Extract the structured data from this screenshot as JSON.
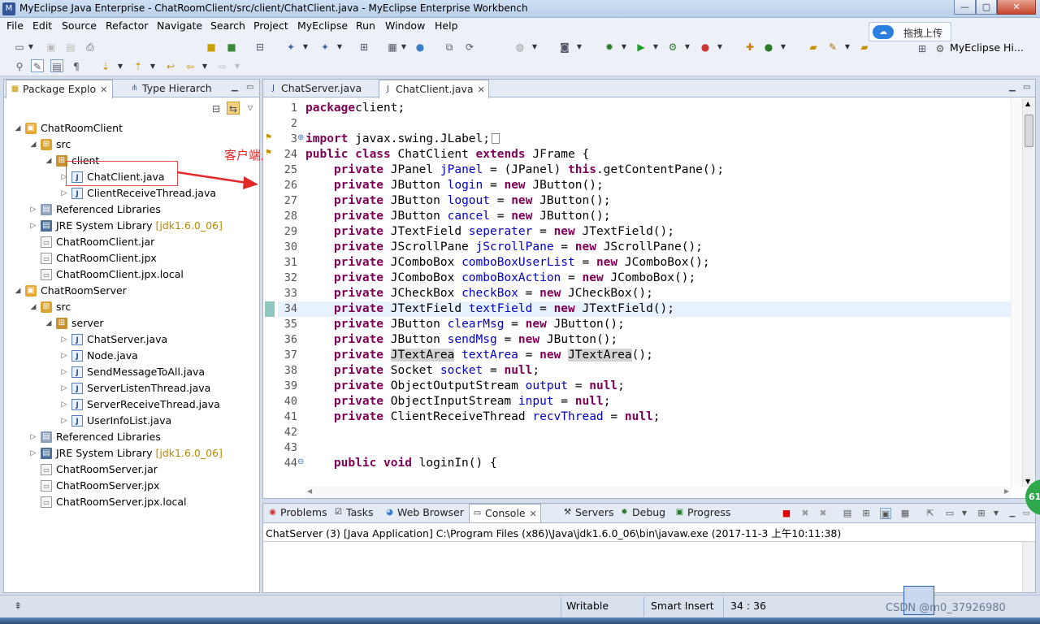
{
  "window": {
    "title": "MyEclipse Java Enterprise - ChatRoomClient/src/client/ChatClient.java - MyEclipse Enterprise Workbench",
    "app_icon": "M",
    "minimize": "—",
    "maximize": "▢",
    "close": "✕"
  },
  "menu": [
    "File",
    "Edit",
    "Source",
    "Refactor",
    "Navigate",
    "Search",
    "Project",
    "MyEclipse",
    "Run",
    "Window",
    "Help"
  ],
  "upload_widget": {
    "label": "拖拽上传",
    "icon": "cloud-icon"
  },
  "perspective": {
    "label": "MyEclipse Hi..."
  },
  "package_explorer": {
    "tabs": [
      {
        "label": "Package Explo",
        "close": "✕",
        "icon": "package-explorer-icon"
      },
      {
        "label": "Type Hierarch",
        "icon": "type-hierarchy-icon"
      }
    ],
    "tree": [
      {
        "depth": 0,
        "expanded": true,
        "icon": "proj",
        "label": "ChatRoomClient"
      },
      {
        "depth": 1,
        "expanded": true,
        "icon": "src",
        "label": "src"
      },
      {
        "depth": 2,
        "expanded": true,
        "icon": "pkg",
        "label": "client"
      },
      {
        "depth": 3,
        "expanded": false,
        "icon": "java",
        "label": "ChatClient.java",
        "selected": true
      },
      {
        "depth": 3,
        "expanded": false,
        "icon": "java",
        "label": "ClientReceiveThread.java"
      },
      {
        "depth": 1,
        "expanded": false,
        "icon": "lib",
        "label": "Referenced Libraries"
      },
      {
        "depth": 1,
        "expanded": false,
        "icon": "jre",
        "label": "JRE System Library",
        "suffix": "[jdk1.6.0_06]"
      },
      {
        "depth": 1,
        "leaf": true,
        "icon": "file",
        "label": "ChatRoomClient.jar"
      },
      {
        "depth": 1,
        "leaf": true,
        "icon": "file",
        "label": "ChatRoomClient.jpx"
      },
      {
        "depth": 1,
        "leaf": true,
        "icon": "file",
        "label": "ChatRoomClient.jpx.local"
      },
      {
        "depth": 0,
        "expanded": true,
        "icon": "proj",
        "label": "ChatRoomServer"
      },
      {
        "depth": 1,
        "expanded": true,
        "icon": "src",
        "label": "src"
      },
      {
        "depth": 2,
        "expanded": true,
        "icon": "pkg",
        "label": "server"
      },
      {
        "depth": 3,
        "expanded": false,
        "icon": "java",
        "label": "ChatServer.java"
      },
      {
        "depth": 3,
        "expanded": false,
        "icon": "java",
        "label": "Node.java"
      },
      {
        "depth": 3,
        "expanded": false,
        "icon": "java",
        "label": "SendMessageToAll.java"
      },
      {
        "depth": 3,
        "expanded": false,
        "icon": "java",
        "label": "ServerListenThread.java"
      },
      {
        "depth": 3,
        "expanded": false,
        "icon": "java",
        "label": "ServerReceiveThread.java"
      },
      {
        "depth": 3,
        "expanded": false,
        "icon": "java",
        "label": "UserInfoList.java"
      },
      {
        "depth": 1,
        "expanded": false,
        "icon": "lib",
        "label": "Referenced Libraries"
      },
      {
        "depth": 1,
        "expanded": false,
        "icon": "jre",
        "label": "JRE System Library",
        "suffix": "[jdk1.6.0_06]"
      },
      {
        "depth": 1,
        "leaf": true,
        "icon": "file",
        "label": "ChatRoomServer.jar"
      },
      {
        "depth": 1,
        "leaf": true,
        "icon": "file",
        "label": "ChatRoomServer.jpx"
      },
      {
        "depth": 1,
        "leaf": true,
        "icon": "file",
        "label": "ChatRoomServer.jpx.local"
      }
    ]
  },
  "annotation": {
    "text": "客户端启动",
    "color": "#e32a2a"
  },
  "editor": {
    "tabs": [
      {
        "label": "ChatServer.java",
        "active": false
      },
      {
        "label": "ChatClient.java",
        "active": true,
        "close": "✕"
      }
    ],
    "current_line": "34",
    "lines": [
      {
        "n": "1",
        "tokens": [
          [
            "kw",
            "package"
          ],
          [
            "",
            "client;"
          ]
        ]
      },
      {
        "n": "2",
        "tokens": []
      },
      {
        "n": "3",
        "fold": "⊕",
        "tokens": [
          [
            "kw",
            "import"
          ],
          [
            "",
            " javax.swing.JLabel;"
          ],
          [
            "box",
            "..."
          ]
        ]
      },
      {
        "n": "24",
        "tokens": [
          [
            "kw",
            "public class"
          ],
          [
            "",
            " ChatClient "
          ],
          [
            "kw",
            "extends"
          ],
          [
            "",
            " JFrame {"
          ]
        ]
      },
      {
        "n": "25",
        "tokens": [
          [
            "",
            "    "
          ],
          [
            "kw",
            "private"
          ],
          [
            "",
            " JPanel "
          ],
          [
            "fld",
            "jPanel"
          ],
          [
            "",
            " = (JPanel) "
          ],
          [
            "kw",
            "this"
          ],
          [
            "",
            ".getContentPane();"
          ]
        ]
      },
      {
        "n": "26",
        "tokens": [
          [
            "",
            "    "
          ],
          [
            "kw",
            "private"
          ],
          [
            "",
            " JButton "
          ],
          [
            "fld",
            "login"
          ],
          [
            "",
            " = "
          ],
          [
            "kw",
            "new"
          ],
          [
            "",
            " JButton();"
          ]
        ]
      },
      {
        "n": "27",
        "tokens": [
          [
            "",
            "    "
          ],
          [
            "kw",
            "private"
          ],
          [
            "",
            " JButton "
          ],
          [
            "fld",
            "logout"
          ],
          [
            "",
            " = "
          ],
          [
            "kw",
            "new"
          ],
          [
            "",
            " JButton();"
          ]
        ]
      },
      {
        "n": "28",
        "tokens": [
          [
            "",
            "    "
          ],
          [
            "kw",
            "private"
          ],
          [
            "",
            " JButton "
          ],
          [
            "fld",
            "cancel"
          ],
          [
            "",
            " = "
          ],
          [
            "kw",
            "new"
          ],
          [
            "",
            " JButton();"
          ]
        ]
      },
      {
        "n": "29",
        "tokens": [
          [
            "",
            "    "
          ],
          [
            "kw",
            "private"
          ],
          [
            "",
            " JTextField "
          ],
          [
            "fld",
            "seperater"
          ],
          [
            "",
            " = "
          ],
          [
            "kw",
            "new"
          ],
          [
            "",
            " JTextField();"
          ]
        ]
      },
      {
        "n": "30",
        "tokens": [
          [
            "",
            "    "
          ],
          [
            "kw",
            "private"
          ],
          [
            "",
            " JScrollPane "
          ],
          [
            "fld",
            "jScrollPane"
          ],
          [
            "",
            " = "
          ],
          [
            "kw",
            "new"
          ],
          [
            "",
            " JScrollPane();"
          ]
        ]
      },
      {
        "n": "31",
        "tokens": [
          [
            "",
            "    "
          ],
          [
            "kw",
            "private"
          ],
          [
            "",
            " JComboBox "
          ],
          [
            "fld",
            "comboBoxUserList"
          ],
          [
            "",
            " = "
          ],
          [
            "kw",
            "new"
          ],
          [
            "",
            " JComboBox();"
          ]
        ]
      },
      {
        "n": "32",
        "tokens": [
          [
            "",
            "    "
          ],
          [
            "kw",
            "private"
          ],
          [
            "",
            " JComboBox "
          ],
          [
            "fld",
            "comboBoxAction"
          ],
          [
            "",
            " = "
          ],
          [
            "kw",
            "new"
          ],
          [
            "",
            " JComboBox();"
          ]
        ]
      },
      {
        "n": "33",
        "tokens": [
          [
            "",
            "    "
          ],
          [
            "kw",
            "private"
          ],
          [
            "",
            " JCheckBox "
          ],
          [
            "fld",
            "checkBox"
          ],
          [
            "",
            " = "
          ],
          [
            "kw",
            "new"
          ],
          [
            "",
            " JCheckBox();"
          ]
        ]
      },
      {
        "n": "34",
        "tokens": [
          [
            "",
            "    "
          ],
          [
            "kw",
            "private"
          ],
          [
            "",
            " JTextField "
          ],
          [
            "fld",
            "textField"
          ],
          [
            "",
            " = "
          ],
          [
            "kw",
            "new"
          ],
          [
            "",
            " JTextField();"
          ]
        ]
      },
      {
        "n": "35",
        "tokens": [
          [
            "",
            "    "
          ],
          [
            "kw",
            "private"
          ],
          [
            "",
            " JButton "
          ],
          [
            "fld",
            "clearMsg"
          ],
          [
            "",
            " = "
          ],
          [
            "kw",
            "new"
          ],
          [
            "",
            " JButton();"
          ]
        ]
      },
      {
        "n": "36",
        "tokens": [
          [
            "",
            "    "
          ],
          [
            "kw",
            "private"
          ],
          [
            "",
            " JButton "
          ],
          [
            "fld",
            "sendMsg"
          ],
          [
            "",
            " = "
          ],
          [
            "kw",
            "new"
          ],
          [
            "",
            " JButton();"
          ]
        ]
      },
      {
        "n": "37",
        "tokens": [
          [
            "",
            "    "
          ],
          [
            "kw",
            "private"
          ],
          [
            "",
            " "
          ],
          [
            "occ",
            "JTextArea"
          ],
          [
            "",
            " "
          ],
          [
            "fld",
            "textArea"
          ],
          [
            "",
            " = "
          ],
          [
            "kw",
            "new"
          ],
          [
            "",
            " "
          ],
          [
            "occ",
            "JTextArea"
          ],
          [
            "",
            "();"
          ]
        ]
      },
      {
        "n": "38",
        "tokens": [
          [
            "",
            "    "
          ],
          [
            "kw",
            "private"
          ],
          [
            "",
            " Socket "
          ],
          [
            "fld",
            "socket"
          ],
          [
            "",
            " = "
          ],
          [
            "kw",
            "null"
          ],
          [
            "",
            ";"
          ]
        ]
      },
      {
        "n": "39",
        "tokens": [
          [
            "",
            "    "
          ],
          [
            "kw",
            "private"
          ],
          [
            "",
            " ObjectOutputStream "
          ],
          [
            "fld",
            "output"
          ],
          [
            "",
            " = "
          ],
          [
            "kw",
            "null"
          ],
          [
            "",
            ";"
          ]
        ]
      },
      {
        "n": "40",
        "tokens": [
          [
            "",
            "    "
          ],
          [
            "kw",
            "private"
          ],
          [
            "",
            " ObjectInputStream "
          ],
          [
            "fld",
            "input"
          ],
          [
            "",
            " = "
          ],
          [
            "kw",
            "null"
          ],
          [
            "",
            ";"
          ]
        ]
      },
      {
        "n": "41",
        "tokens": [
          [
            "",
            "    "
          ],
          [
            "kw",
            "private"
          ],
          [
            "",
            " ClientReceiveThread "
          ],
          [
            "fld",
            "recvThread"
          ],
          [
            "",
            " = "
          ],
          [
            "kw",
            "null"
          ],
          [
            "",
            ";"
          ]
        ]
      },
      {
        "n": "42",
        "tokens": []
      },
      {
        "n": "43",
        "tokens": []
      },
      {
        "n": "44",
        "fold": "⊖",
        "tokens": [
          [
            "",
            "    "
          ],
          [
            "kw",
            "public void"
          ],
          [
            "",
            " loginIn() {"
          ]
        ]
      }
    ]
  },
  "console": {
    "tabs": [
      {
        "label": "Problems",
        "icon": "problems-icon"
      },
      {
        "label": "Tasks",
        "icon": "tasks-icon"
      },
      {
        "label": "Web Browser",
        "icon": "web-browser-icon"
      },
      {
        "label": "Console",
        "icon": "console-icon",
        "active": true,
        "close": "✕"
      },
      {
        "label": "Servers",
        "icon": "servers-icon"
      },
      {
        "label": "Debug",
        "icon": "debug-icon"
      },
      {
        "label": "Progress",
        "icon": "progress-icon"
      }
    ],
    "process_line": "ChatServer (3) [Java Application] C:\\Program Files (x86)\\Java\\jdk1.6.0_06\\bin\\javaw.exe (2017-11-3 上午10:11:38)"
  },
  "status": {
    "writable": "Writable",
    "insert_mode": "Smart Insert",
    "position": "34 : 36"
  },
  "watermark": "CSDN @m0_37926980",
  "badge": "61"
}
